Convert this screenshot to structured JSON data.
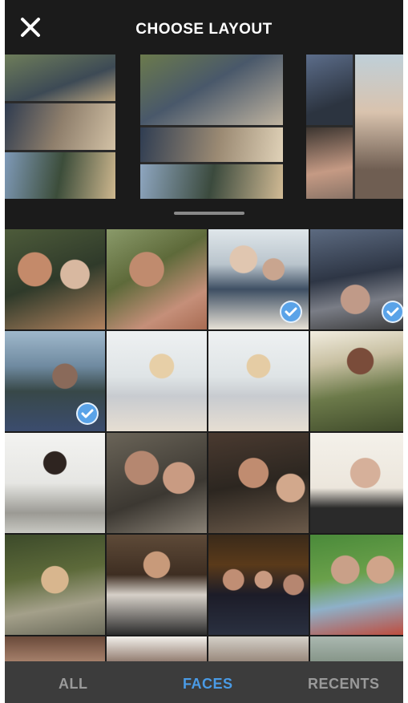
{
  "header": {
    "title": "CHOOSE LAYOUT"
  },
  "tabs": [
    {
      "label": "ALL",
      "active": false
    },
    {
      "label": "FACES",
      "active": true
    },
    {
      "label": "RECENTS",
      "active": false
    }
  ],
  "colors": {
    "accent": "#4a9be6",
    "selection": "#5aa3e8",
    "background": "#1b1b1b",
    "tabbar": "#3c3c3c"
  },
  "icons": {
    "close": "close-icon",
    "check": "checkmark-icon"
  },
  "photos": [
    {
      "selected": false
    },
    {
      "selected": false
    },
    {
      "selected": true
    },
    {
      "selected": true
    },
    {
      "selected": true
    },
    {
      "selected": false
    },
    {
      "selected": false
    },
    {
      "selected": false
    },
    {
      "selected": false
    },
    {
      "selected": false
    },
    {
      "selected": false
    },
    {
      "selected": false
    },
    {
      "selected": false
    },
    {
      "selected": false
    },
    {
      "selected": false
    },
    {
      "selected": false
    },
    {
      "selected": false
    },
    {
      "selected": false
    },
    {
      "selected": false
    },
    {
      "selected": false
    }
  ]
}
